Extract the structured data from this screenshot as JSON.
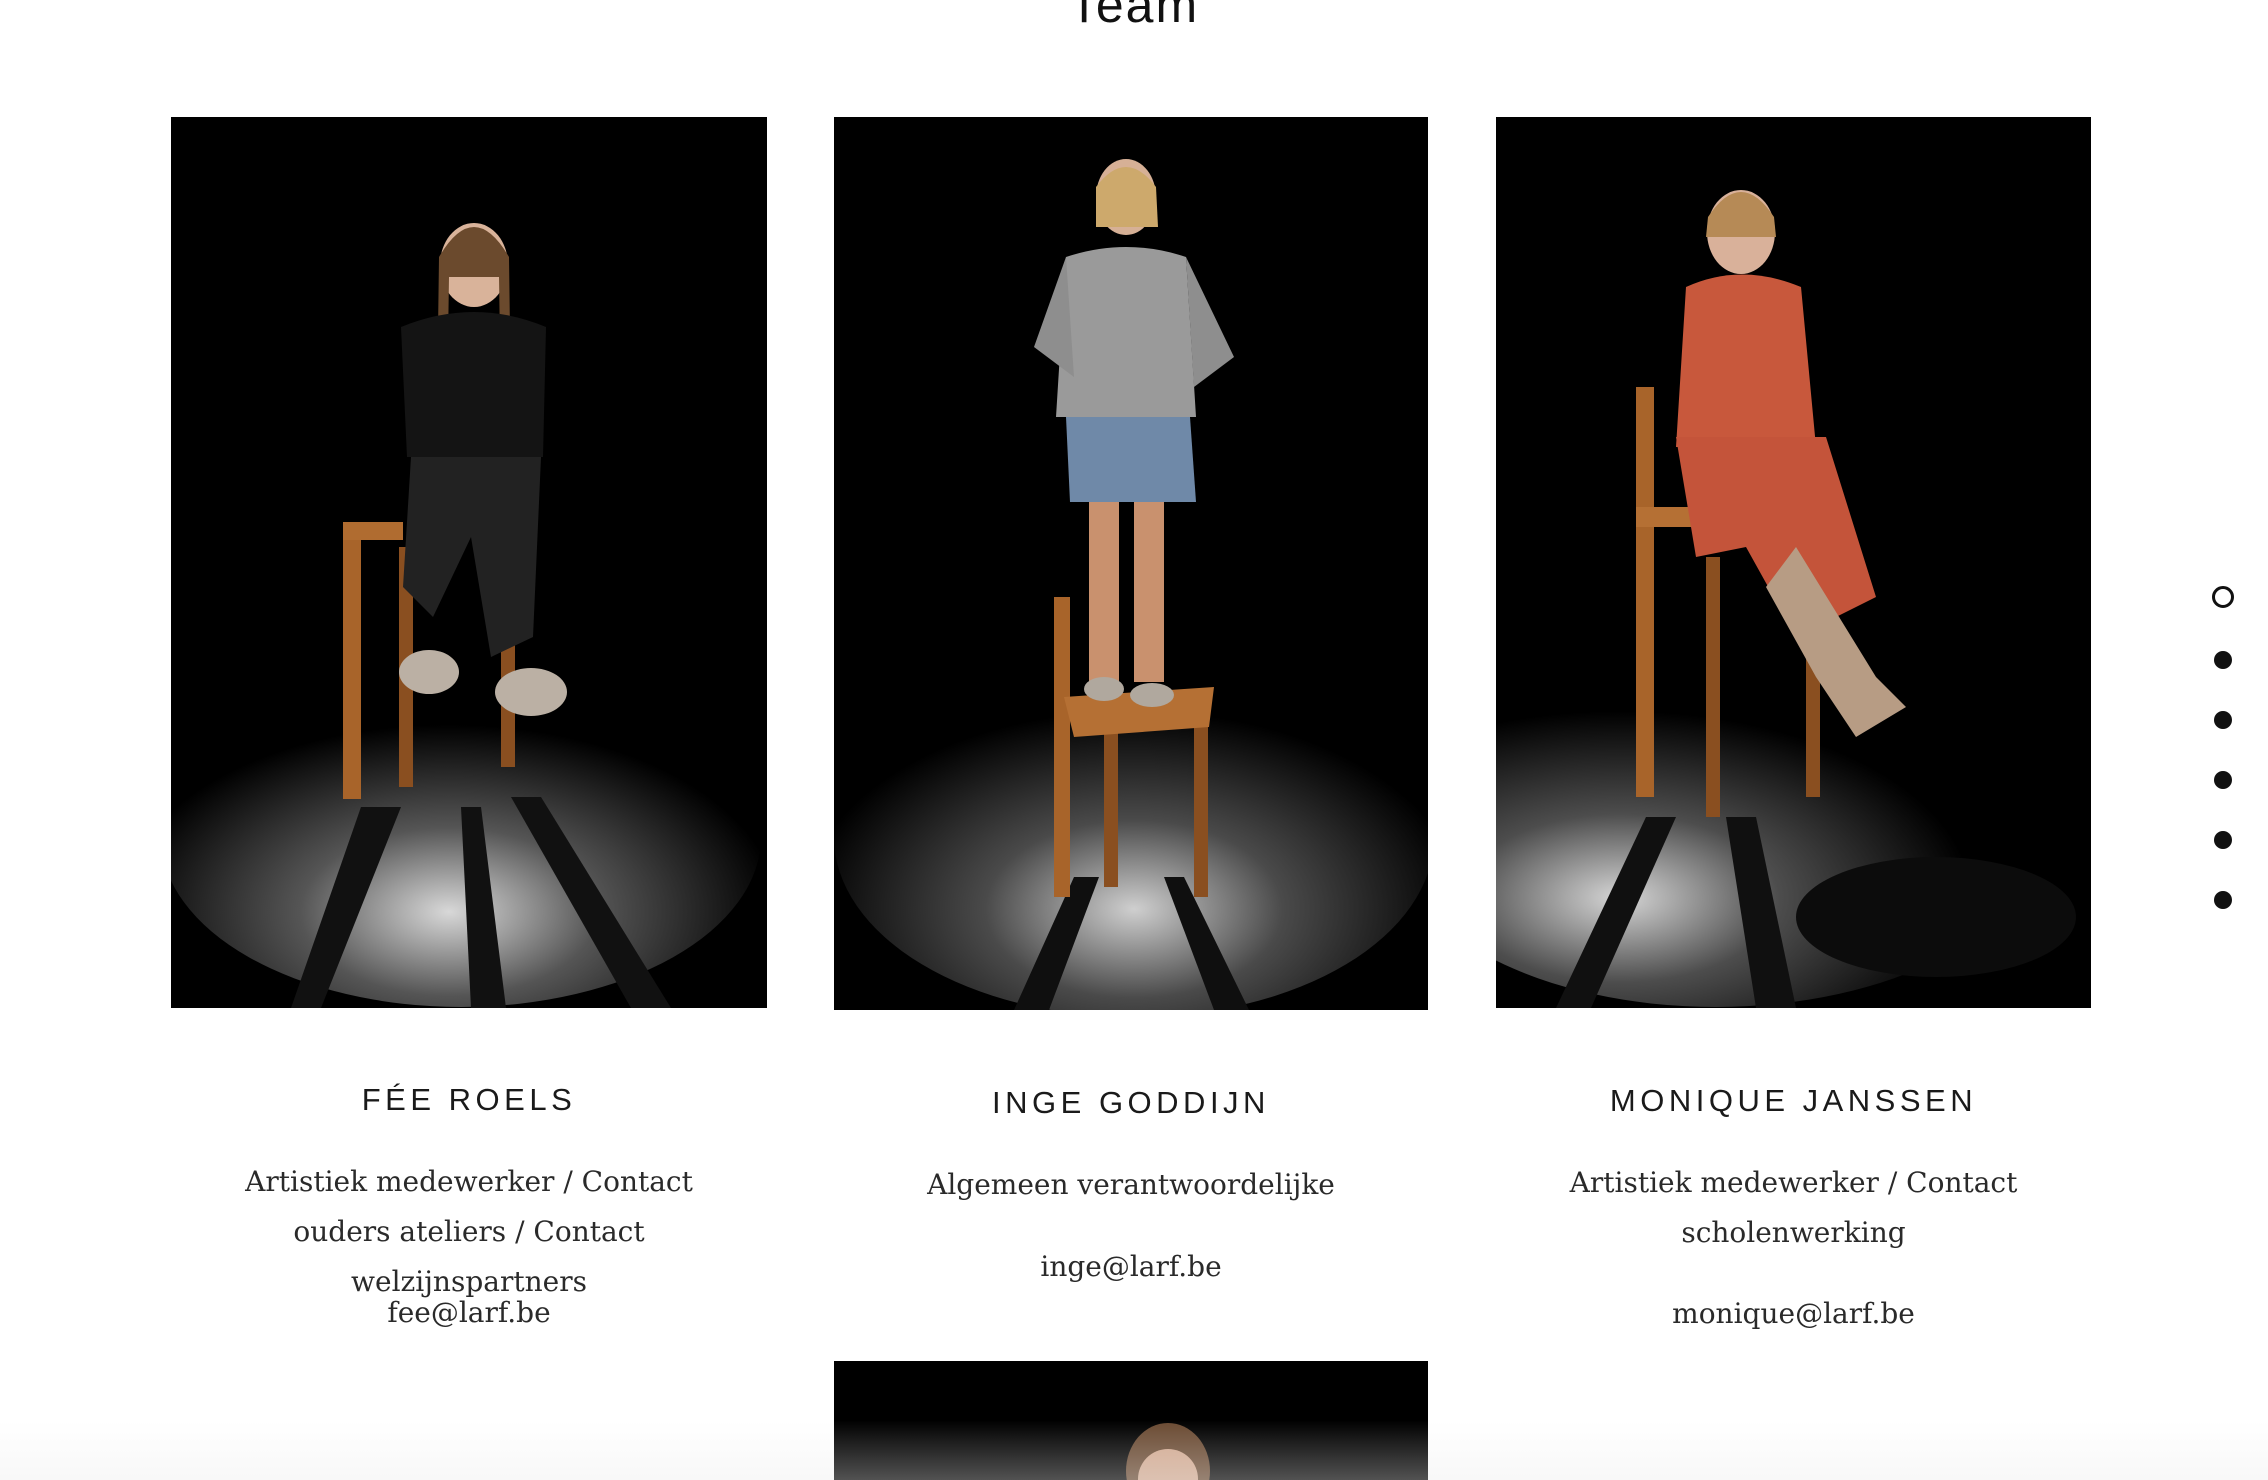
{
  "section": {
    "title": "Team"
  },
  "team": [
    {
      "name": "FÉE ROELS",
      "role": "Artistiek medewerker / Contact ouders ateliers / Contact welzijnspartners",
      "email": "fee@larf.be"
    },
    {
      "name": "INGE GODDIJN",
      "role": "Algemeen verantwoordelijke",
      "email": "inge@larf.be"
    },
    {
      "name": "MONIQUE JANSSEN",
      "role": "Artistiek medewerker / Contact scholenwerking",
      "email": "monique@larf.be"
    }
  ],
  "dot_nav": {
    "count": 6,
    "active_index": 0
  },
  "colors": {
    "text": "#1a1a1a",
    "photo_bg": "#000000",
    "dress": "#c8583c"
  }
}
